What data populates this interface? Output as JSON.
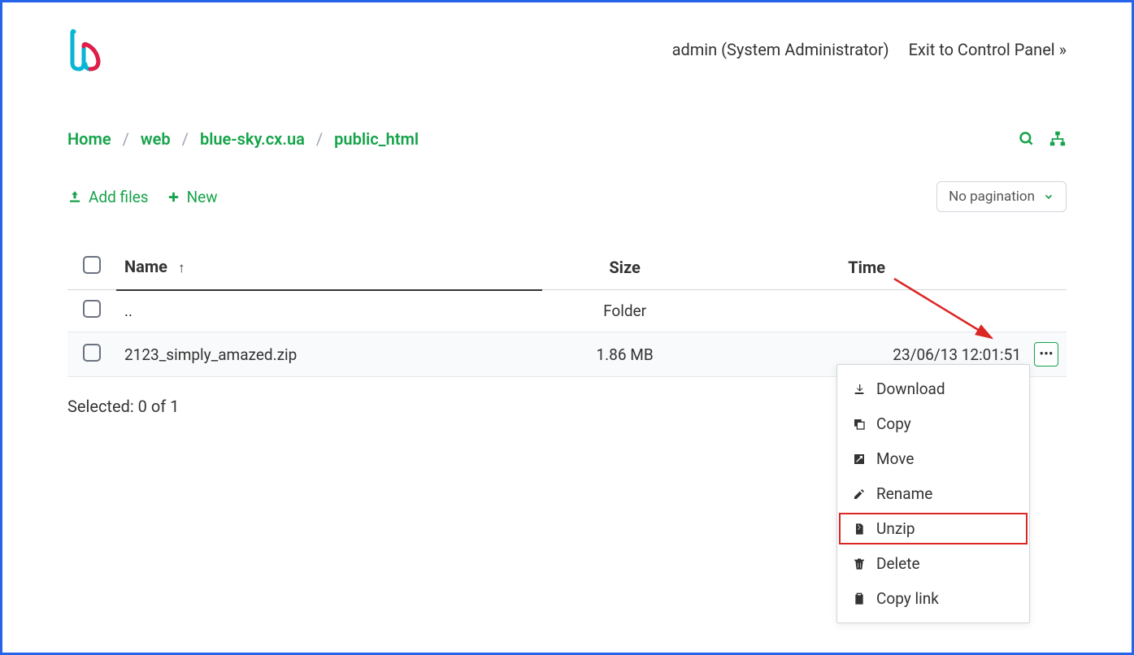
{
  "header": {
    "user_label": "admin (System Administrator)",
    "exit_label": "Exit to Control Panel »"
  },
  "breadcrumb": {
    "items": [
      "Home",
      "web",
      "blue-sky.cx.ua",
      "public_html"
    ]
  },
  "actions": {
    "add_files": "Add files",
    "new": "New",
    "pagination": "No pagination"
  },
  "table": {
    "headers": {
      "name": "Name",
      "size": "Size",
      "time": "Time"
    },
    "rows": [
      {
        "name": "..",
        "size": "Folder",
        "time": ""
      },
      {
        "name": "2123_simply_amazed.zip",
        "size": "1.86 MB",
        "time": "23/06/13 12:01:51"
      }
    ]
  },
  "selected_text": "Selected: 0 of 1",
  "menu": {
    "download": "Download",
    "copy": "Copy",
    "move": "Move",
    "rename": "Rename",
    "unzip": "Unzip",
    "delete": "Delete",
    "copy_link": "Copy link"
  }
}
